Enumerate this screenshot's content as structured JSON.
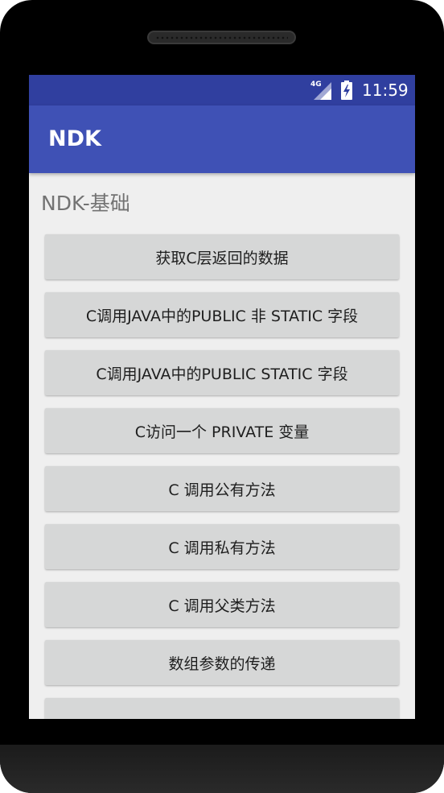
{
  "status_bar": {
    "network_label": "4G",
    "time": "11:59",
    "icons": [
      "signal-4g-icon",
      "battery-charging-icon"
    ]
  },
  "app_bar": {
    "title": "NDK"
  },
  "section_title": "NDK-基础",
  "buttons": [
    "获取C层返回的数据",
    "C调用JAVA中的PUBLIC 非 STATIC 字段",
    "C调用JAVA中的PUBLIC STATIC 字段",
    "C访问一个 PRIVATE 变量",
    "C 调用公有方法",
    "C 调用私有方法",
    "C 调用父类方法",
    "数组参数的传递",
    ""
  ],
  "colors": {
    "status_bar": "#303f9f",
    "app_bar": "#3f51b5",
    "background": "#efefef",
    "button": "#d6d7d7",
    "section_title": "#737373"
  }
}
